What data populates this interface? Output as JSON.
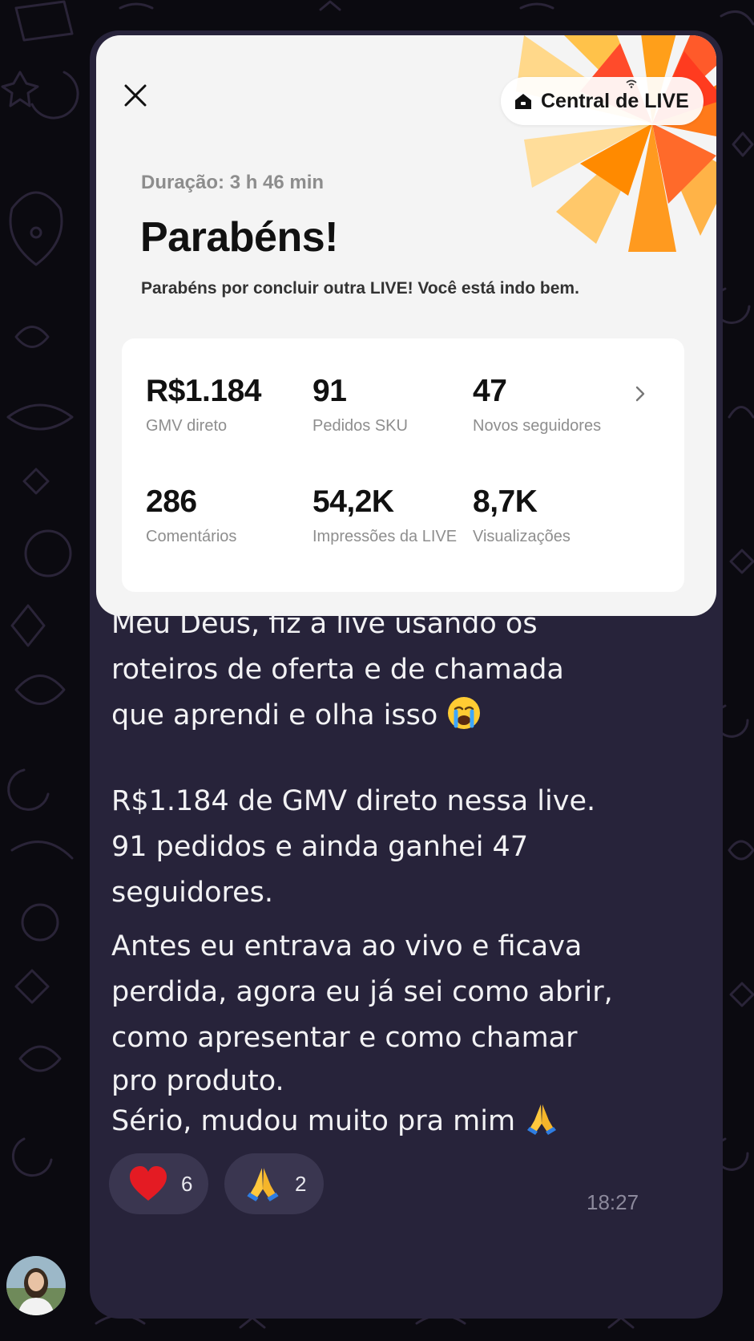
{
  "card": {
    "live_center_label": "Central de LIVE",
    "duration": "Duração: 3 h 46 min",
    "title": "Parabéns!",
    "subtitle": "Parabéns por concluir outra LIVE! Você está indo bem.",
    "stats": [
      {
        "value": "R$1.184",
        "label": "GMV direto"
      },
      {
        "value": "91",
        "label": "Pedidos SKU"
      },
      {
        "value": "47",
        "label": "Novos seguidores"
      },
      {
        "value": "286",
        "label": "Comentários"
      },
      {
        "value": "54,2K",
        "label": "Impressões da LIVE"
      },
      {
        "value": "8,7K",
        "label": "Visualizações"
      }
    ]
  },
  "message": {
    "para1": [
      "Meu Deus, fiz a live usando os",
      "roteiros de oferta e de chamada",
      "que aprendi e olha isso"
    ],
    "para2": [
      "R$1.184 de GMV direto nessa live.",
      "91 pedidos e ainda ganhei 47",
      "seguidores."
    ],
    "para3": [
      "Antes eu entrava ao vivo e ficava",
      "perdida, agora eu já sei como abrir,",
      "como apresentar e como chamar",
      "pro produto.",
      "Sério, mudou muito pra mim"
    ],
    "time": "18:27"
  },
  "reactions": [
    {
      "icon": "heart-icon",
      "count": "6"
    },
    {
      "icon": "praying-hands-icon",
      "count": "2"
    }
  ],
  "colors": {
    "background": "#0b0a10",
    "bubble": "#27233a",
    "card": "#f4f4f4",
    "burst_orange": "#ff8a00",
    "burst_red": "#ff3b1f"
  }
}
